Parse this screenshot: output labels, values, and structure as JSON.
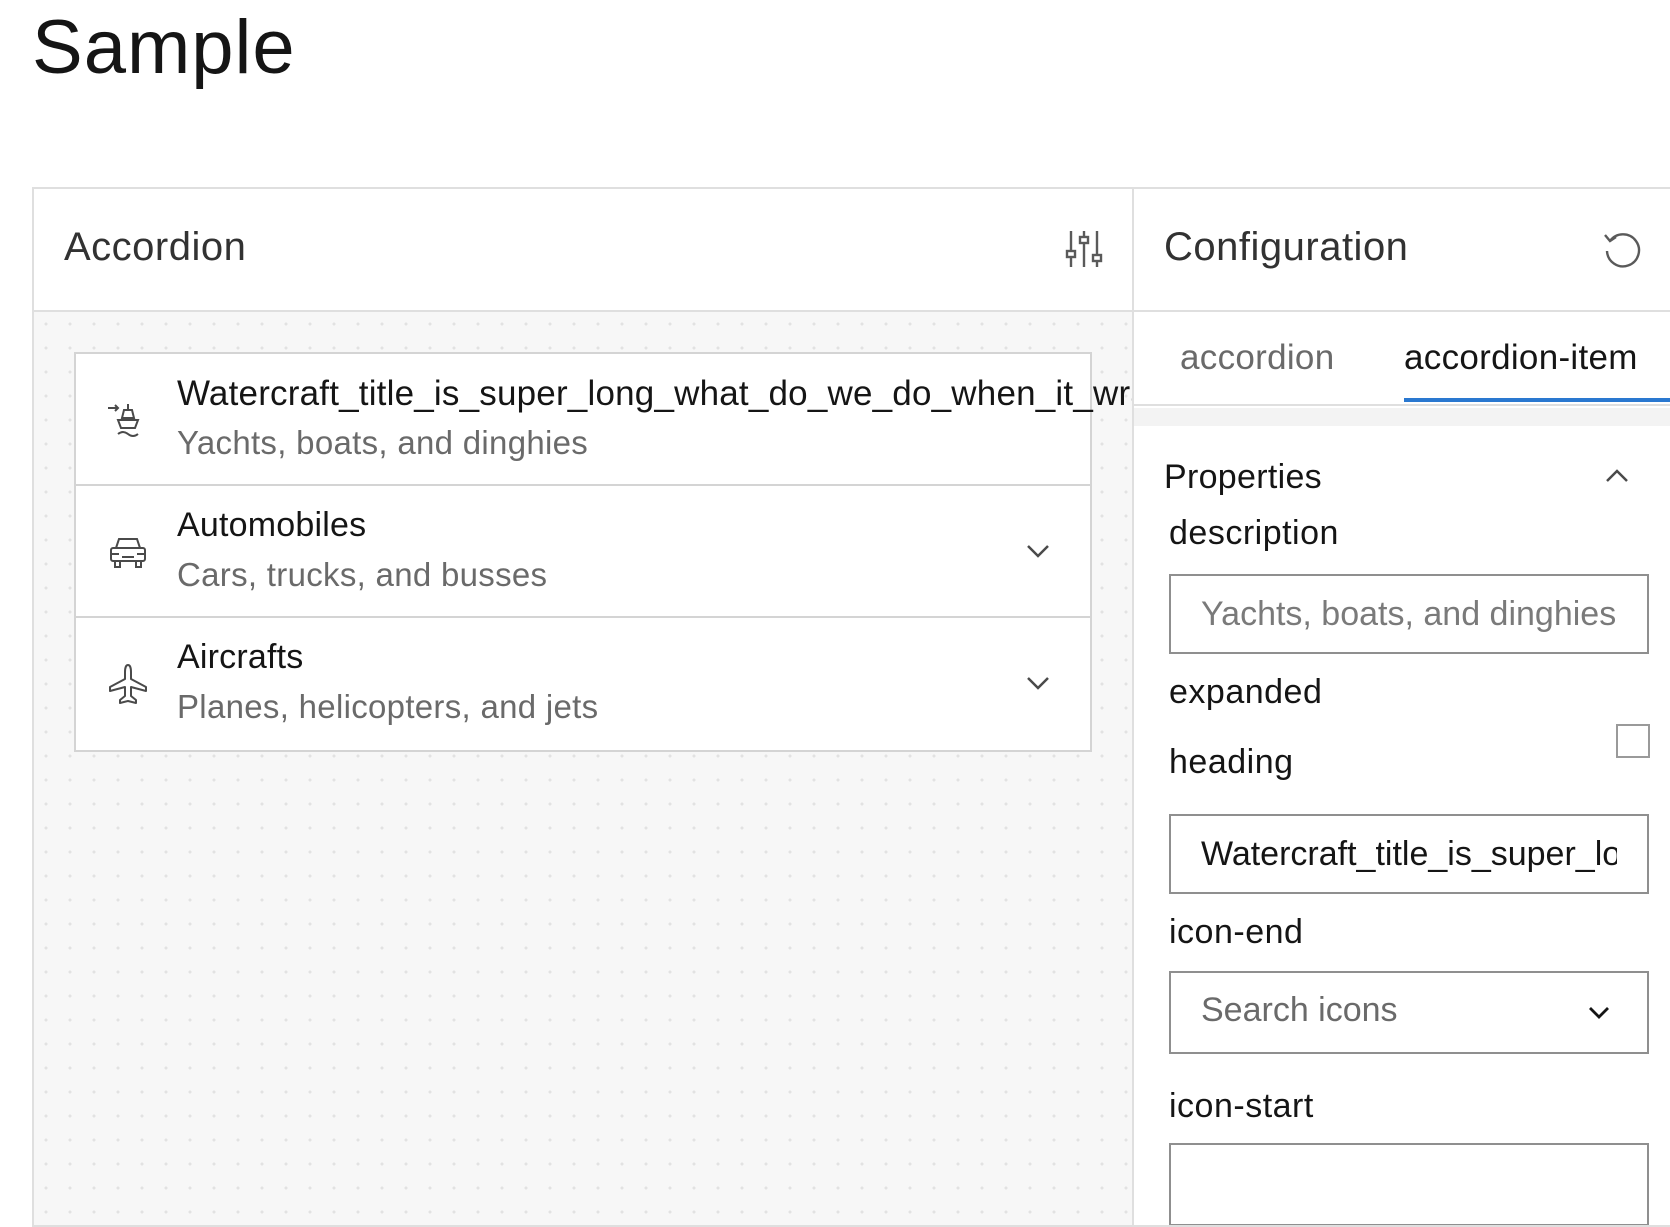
{
  "page": {
    "title": "Sample"
  },
  "preview": {
    "title": "Accordion",
    "settings_icon": "sliders-icon",
    "items": [
      {
        "heading": "Watercraft_title_is_super_long_what_do_we_do_when_it_wraps",
        "description": "Yachts, boats, and dinghies",
        "icon": "boat-icon",
        "expanded": false
      },
      {
        "heading": "Automobiles",
        "description": "Cars, trucks, and busses",
        "icon": "car-icon",
        "expanded": false
      },
      {
        "heading": "Aircrafts",
        "description": "Planes, helicopters, and jets",
        "icon": "plane-icon",
        "expanded": false
      }
    ]
  },
  "config": {
    "title": "Configuration",
    "reset_icon": "reset-icon",
    "tabs": [
      {
        "label": "accordion",
        "active": false
      },
      {
        "label": "accordion-item",
        "active": true
      }
    ],
    "section": {
      "title": "Properties",
      "collapsed": false
    },
    "fields": {
      "description": {
        "label": "description",
        "placeholder": "Yachts, boats, and dinghies",
        "value": ""
      },
      "expanded": {
        "label": "expanded",
        "checked": false
      },
      "heading": {
        "label": "heading",
        "value": "Watercraft_title_is_super_long_what_do_we_do_when_it_wraps"
      },
      "icon_end": {
        "label": "icon-end",
        "placeholder": "Search icons"
      },
      "icon_start": {
        "label": "icon-start"
      }
    }
  },
  "colors": {
    "accent": "#2a78d0",
    "border": "#dfdfdf",
    "canvas": "#f7f7f7"
  }
}
